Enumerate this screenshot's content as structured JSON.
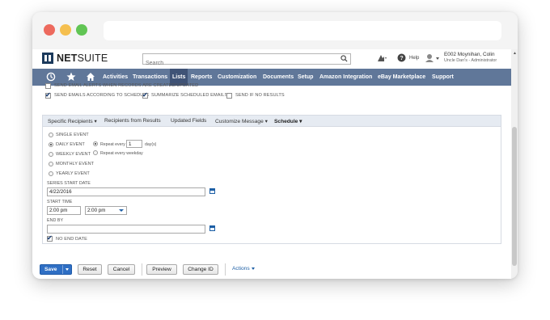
{
  "header": {
    "logo_bold": "NET",
    "logo_light": "SUITE",
    "search_placeholder": "Search",
    "help_label": "Help",
    "user_name": "E002 Moynihan, Colin",
    "user_role": "Uncle Dan's - Administrator"
  },
  "nav": {
    "icons": [
      "recent-icon",
      "star-icon",
      "home-icon"
    ],
    "items": [
      "Activities",
      "Transactions",
      "Lists",
      "Reports",
      "Customization",
      "Documents",
      "Setup",
      "Amazon Integration",
      "eBay Marketplace",
      "Support"
    ],
    "active": "Lists",
    "colors": {
      "bar": "#607799",
      "active": "#3f5376"
    }
  },
  "email_options": {
    "alerts_on_create_update": {
      "label": "SEND EMAIL ALERTS WHEN RECORDS ARE CREATED/UPDATED",
      "checked": false
    },
    "according_to_schedule": {
      "label": "SEND EMAILS ACCORDING TO SCHEDULE",
      "checked": true
    },
    "summarize": {
      "label": "SUMMARIZE SCHEDULED EMAILS",
      "checked": true
    },
    "if_no_results": {
      "label": "SEND IF NO RESULTS",
      "checked": false
    }
  },
  "tabs": [
    "Specific Recipients",
    "Recipients from Results",
    "Updated Fields",
    "Customize Message",
    "Schedule"
  ],
  "active_tab": "Schedule",
  "schedule": {
    "frequencies": [
      "SINGLE EVENT",
      "DAILY EVENT",
      "WEEKLY EVENT",
      "MONTHLY EVENT",
      "YEARLY EVENT"
    ],
    "selected_frequency": "DAILY EVENT",
    "repeat_every_label": "Repeat every",
    "repeat_every_value": "1",
    "repeat_unit": "day(s)",
    "repeat_weekday_label": "Repeat every weekday",
    "series_start_label": "SERIES START DATE",
    "series_start_value": "4/22/2016",
    "start_time_label": "START TIME",
    "start_time_value": "2:00 pm",
    "start_time_select": "2:00 pm",
    "end_by_label": "END BY",
    "end_by_value": "",
    "no_end_date": {
      "label": "NO END DATE",
      "checked": true
    }
  },
  "buttons": {
    "save": "Save",
    "reset": "Reset",
    "cancel": "Cancel",
    "preview": "Preview",
    "change_id": "Change ID",
    "actions": "Actions"
  }
}
